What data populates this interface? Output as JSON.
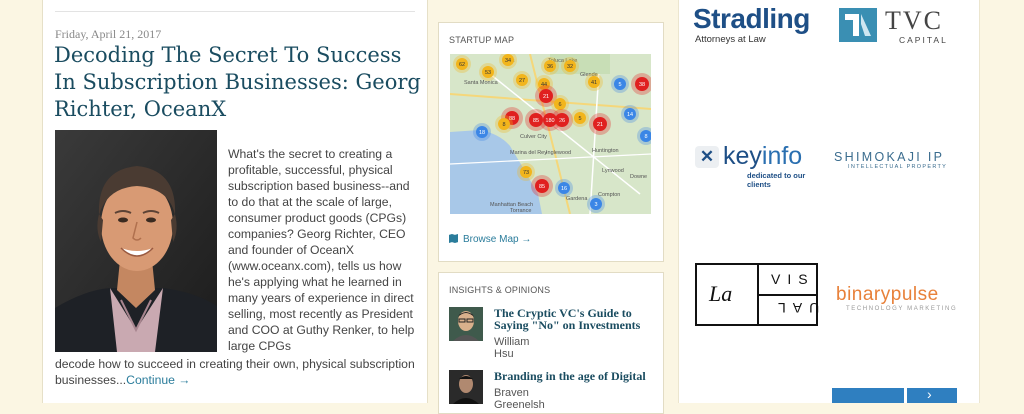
{
  "article": {
    "date": "Friday, April 21, 2017",
    "title": "Decoding The Secret To Success In Subscription Businesses: Georg Richter, OceanX",
    "excerpt_side": "What's the secret to creating a profitable, successful, physical subscription based business--and to do that at the scale of large, consumer product goods (CPGs) companies? Georg Richter, CEO and founder of OceanX (www.oceanx.com), tells us how he's applying what he learned in many years of experience in direct selling, most recently as President and COO at Guthy Renker, to help large CPGs",
    "excerpt_bottom": "decode how to succeed in creating their own, physical subscription businesses...",
    "continue_label": "Continue →"
  },
  "startup_map": {
    "heading": "STARTUP MAP",
    "browse_label": "Browse Map →",
    "place_labels": [
      "Nuys",
      "Toluca Lake",
      "Glende",
      "Santa Monica",
      "Culver City",
      "Marina del Rey",
      "Inglewood",
      "Huntington",
      "Lynwood",
      "Downe",
      "Manhattan Beach",
      "Gardena",
      "Compton",
      "Torrance"
    ],
    "cluster_labels": [
      "62",
      "34",
      "53",
      "36",
      "32",
      "27",
      "44",
      "41",
      "5",
      "38",
      "88",
      "21",
      "6",
      "26",
      "180",
      "21",
      "14",
      "5",
      "18",
      "8",
      "85",
      "85",
      "73",
      "16",
      "3",
      "8"
    ]
  },
  "insights": {
    "heading": "INSIGHTS & OPINIONS",
    "items": [
      {
        "title": "The Cryptic VC's Guide to Saying \"No\" on Investments",
        "author": "William Hsu"
      },
      {
        "title": "Branding in the age of Digital",
        "author": "Braven Greenelsh"
      }
    ]
  },
  "sponsors": {
    "stradling_name": "Stradling",
    "stradling_sub": "Attorneys at Law",
    "tvc_name": "TVC",
    "tvc_sub": "CAPITAL",
    "keyinfo_key": "key",
    "keyinfo_info": "info",
    "keyinfo_sub": "dedicated to our clients",
    "shimokaji_name": "SHIMOKAJI IP",
    "shimokaji_sub": "INTELLECTUAL PROPERTY",
    "lavisual_la": "La",
    "lavisual_vis": "VIS",
    "lavisual_ual": "UAL",
    "binarypulse_name": "binarypulse",
    "binarypulse_sub": "TECHNOLOGY MARKETING"
  },
  "colors": {
    "link": "#2a7c9b",
    "title": "#1a4c60",
    "page_bg": "#fbf6e3",
    "cluster_red": "#e02020",
    "cluster_yellow": "#f2b51c",
    "cluster_blue": "#3b86e6"
  }
}
